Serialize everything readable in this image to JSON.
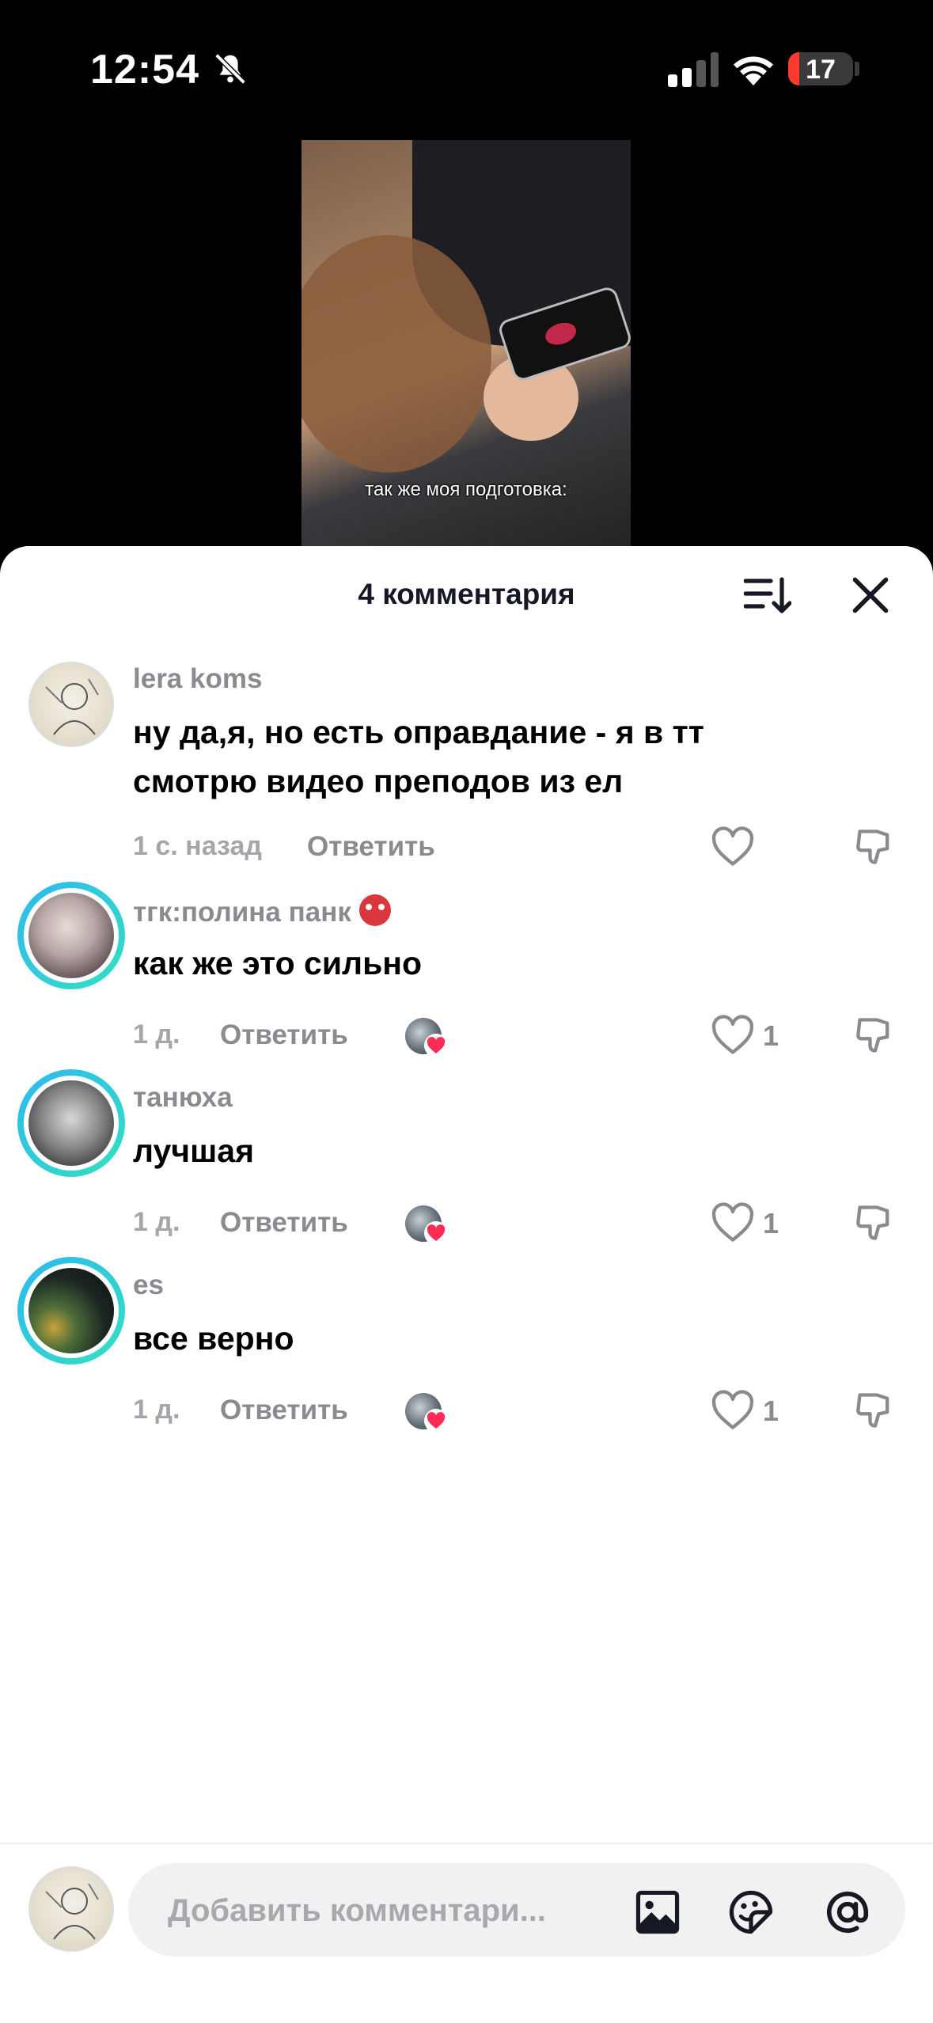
{
  "status_bar": {
    "time": "12:54",
    "battery": "17"
  },
  "video": {
    "caption": "так же моя подготовка:"
  },
  "sheet": {
    "title": "4 комментария"
  },
  "comments": [
    {
      "username": "lera koms",
      "text": "ну да,я, но есть оправдание - я в тт смотрю видео преподов из ел",
      "time": "1 с. назад",
      "reply": "Ответить",
      "likes": ""
    },
    {
      "username": "тгк:полина панк",
      "text": "как же это сильно",
      "time": "1 д.",
      "reply": "Ответить",
      "likes": "1"
    },
    {
      "username": "танюха",
      "text": "лучшая",
      "time": "1 д.",
      "reply": "Ответить",
      "likes": "1"
    },
    {
      "username": "es",
      "text": "все верно",
      "time": "1 д.",
      "reply": "Ответить",
      "likes": "1"
    }
  ],
  "composer": {
    "placeholder": "Добавить комментари..."
  },
  "colors": {
    "like_heart": "#fe2c55",
    "ring_from": "#2fb8f0",
    "ring_to": "#34e0c0"
  }
}
